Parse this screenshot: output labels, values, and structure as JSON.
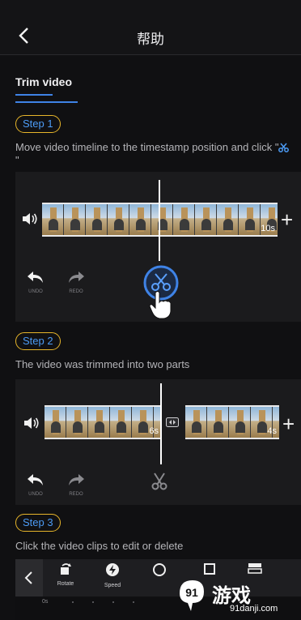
{
  "header": {
    "title": "帮助"
  },
  "section": {
    "title": "Trim video"
  },
  "steps": [
    {
      "label": "Step 1",
      "desc_before": "Move video timeline to the timestamp position and click \"",
      "desc_after": "\""
    },
    {
      "label": "Step 2",
      "desc": "The video was trimmed into two parts"
    },
    {
      "label": "Step 3",
      "desc": "Click the video clips to edit or delete"
    }
  ],
  "panel1": {
    "duration": "10s",
    "undo": "UNDO",
    "redo": "REDO"
  },
  "panel2": {
    "left_duration": "6s",
    "right_duration": "4s",
    "undo": "UNDO",
    "redo": "REDO"
  },
  "bottom_bar": {
    "rotate": "Rotate",
    "speed": "Speed",
    "time": "0s"
  },
  "watermark": {
    "text": "游戏",
    "brand": "91",
    "url": "91danji.com"
  },
  "colors": {
    "accent": "#3f83e6",
    "pill_border": "#e7b52a",
    "scissors_blue": "#4c9bf5"
  }
}
